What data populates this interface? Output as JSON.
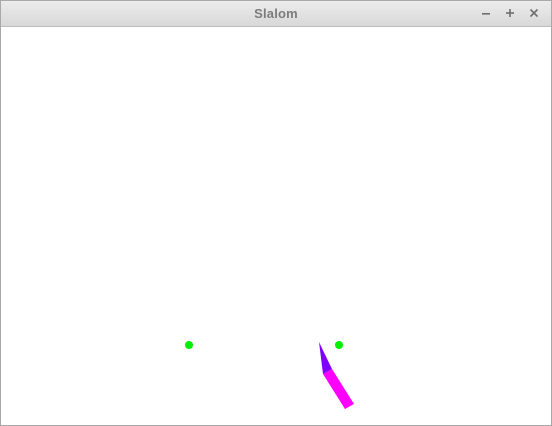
{
  "window": {
    "title": "Slalom",
    "controls": [
      "minimize-icon",
      "maximize-icon",
      "close-icon"
    ]
  },
  "game": {
    "background_color": "#ffffff",
    "gate_color": "#00ee00",
    "skier_body_color": "#ff00ff",
    "skier_tip_color": "#8000ff",
    "gates": [
      {
        "id": "gate-left"
      },
      {
        "id": "gate-right"
      }
    ]
  }
}
